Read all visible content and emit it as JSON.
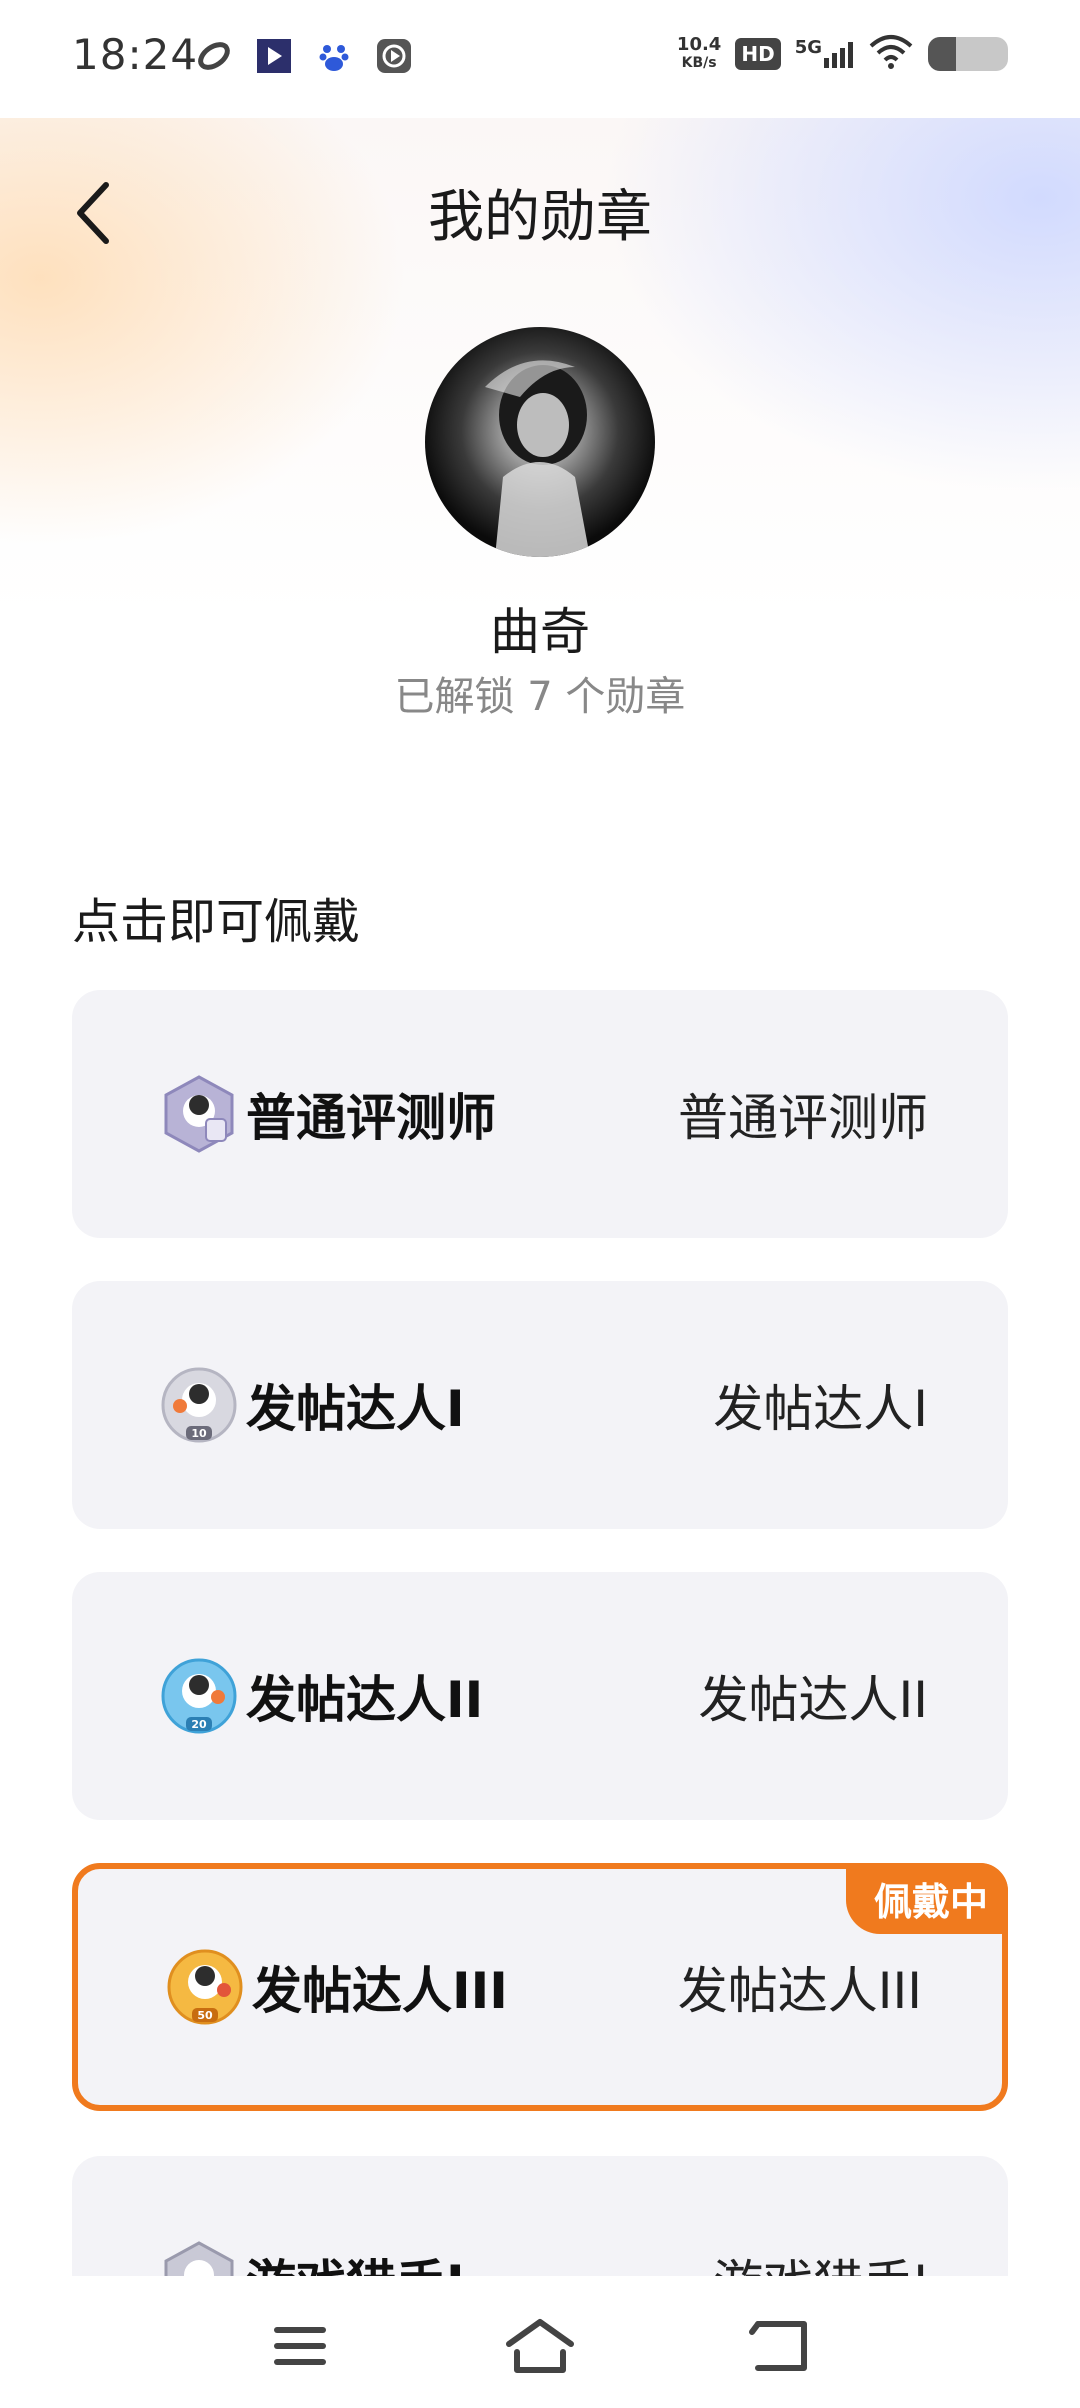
{
  "status_bar": {
    "time": "18:24",
    "net_speed_value": "10.4",
    "net_speed_unit": "KB/s",
    "hd_label": "HD",
    "network_label": "5G",
    "battery_level": 0.35
  },
  "header": {
    "title": "我的勋章"
  },
  "profile": {
    "name": "曲奇",
    "unlocked_text": "已解锁 7 个勋章"
  },
  "section": {
    "label": "点击即可佩戴"
  },
  "badges": [
    {
      "name": "普通评测师",
      "desc": "普通评测师",
      "icon": "reviewer-badge-icon",
      "color": "#b8b3d6",
      "wearing": false
    },
    {
      "name": "发帖达人I",
      "desc": "发帖达人I",
      "icon": "poster-badge-1-icon",
      "color": "#d8d8e0",
      "number": "10",
      "wearing": false
    },
    {
      "name": "发帖达人II",
      "desc": "发帖达人II",
      "icon": "poster-badge-2-icon",
      "color": "#79c6ee",
      "number": "20",
      "wearing": false
    },
    {
      "name": "发帖达人III",
      "desc": "发帖达人III",
      "icon": "poster-badge-3-icon",
      "color": "#f5b942",
      "number": "50",
      "wearing": true,
      "wearing_label": "佩戴中"
    },
    {
      "name": "游戏猎手I",
      "desc": "游戏猎手I",
      "icon": "game-hunter-badge-icon",
      "color": "#c9c9d6",
      "wearing": false
    }
  ],
  "nav": {
    "menu_icon": "menu-icon",
    "home_icon": "home-icon",
    "back_icon": "back-icon"
  },
  "colors": {
    "accent": "#f07a1e",
    "card_bg": "#f3f3f7"
  }
}
